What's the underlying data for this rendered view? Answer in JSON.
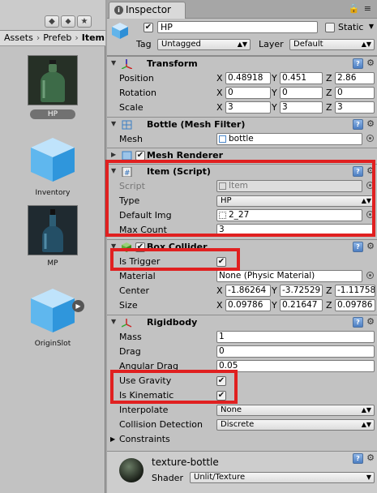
{
  "project": {
    "breadcrumbs": [
      "Assets",
      "Prefeb",
      "Item"
    ],
    "assets": [
      {
        "name": "HP",
        "selected": true
      },
      {
        "name": "Inventory",
        "selected": false
      },
      {
        "name": "MP",
        "selected": false
      },
      {
        "name": "OriginSlot",
        "selected": false
      }
    ]
  },
  "inspector": {
    "tab_label": "Inspector",
    "object": {
      "name": "HP",
      "static_label": "Static",
      "tag_label": "Tag",
      "tag_value": "Untagged",
      "layer_label": "Layer",
      "layer_value": "Default"
    },
    "transform": {
      "title": "Transform",
      "position_label": "Position",
      "rotation_label": "Rotation",
      "scale_label": "Scale",
      "axes": [
        "X",
        "Y",
        "Z"
      ],
      "position": [
        "0.48918",
        "0.451",
        "2.86"
      ],
      "rotation": [
        "0",
        "0",
        "0"
      ],
      "scale": [
        "3",
        "3",
        "3"
      ]
    },
    "mesh_filter": {
      "title": "Bottle (Mesh Filter)",
      "mesh_label": "Mesh",
      "mesh_value": "bottle"
    },
    "mesh_renderer": {
      "title": "Mesh Renderer"
    },
    "item_script": {
      "title": "Item (Script)",
      "script_label": "Script",
      "script_value": "Item",
      "type_label": "Type",
      "type_value": "HP",
      "default_img_label": "Default Img",
      "default_img_value": "2_27",
      "max_count_label": "Max Count",
      "max_count_value": "3"
    },
    "box_collider": {
      "title": "Box Collider",
      "is_trigger_label": "Is Trigger",
      "is_trigger": true,
      "material_label": "Material",
      "material_value": "None (Physic Material)",
      "center_label": "Center",
      "center": [
        "-1.86264",
        "-3.72529",
        "-1.11758"
      ],
      "size_label": "Size",
      "size": [
        "0.09786",
        "0.21647",
        "0.09786"
      ]
    },
    "rigidbody": {
      "title": "Rigidbody",
      "mass_label": "Mass",
      "mass_value": "1",
      "drag_label": "Drag",
      "drag_value": "0",
      "angular_drag_label": "Angular Drag",
      "angular_drag_value": "0.05",
      "use_gravity_label": "Use Gravity",
      "use_gravity": true,
      "is_kinematic_label": "Is Kinematic",
      "is_kinematic": true,
      "interpolate_label": "Interpolate",
      "interpolate_value": "None",
      "collision_detection_label": "Collision Detection",
      "collision_detection_value": "Discrete",
      "constraints_label": "Constraints"
    },
    "material": {
      "name": "texture-bottle",
      "shader_label": "Shader",
      "shader_value": "Unlit/Texture"
    }
  },
  "colors": {
    "highlight_box": "#e02020",
    "selection": "#717171",
    "panel": "#c2c2c2"
  },
  "icons": [
    "lock-icon",
    "tab-menu-icon",
    "create-icon",
    "tag-icon",
    "star-icon",
    "info-icon",
    "cube-icon",
    "transform-icon",
    "mesh-filter-icon",
    "mesh-renderer-icon",
    "script-icon",
    "box-collider-icon",
    "rigidbody-icon",
    "help-book-icon",
    "gear-icon",
    "object-picker-icon",
    "play-icon"
  ]
}
